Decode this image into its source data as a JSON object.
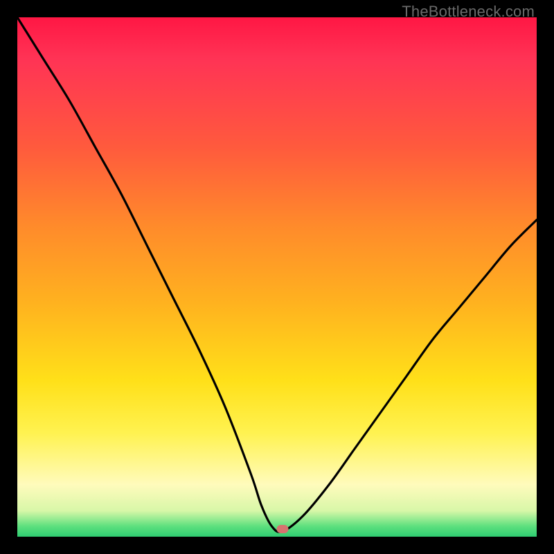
{
  "watermark": "TheBottleneck.com",
  "chart_data": {
    "type": "line",
    "title": "",
    "xlabel": "",
    "ylabel": "",
    "xlim": [
      0,
      100
    ],
    "ylim": [
      0,
      100
    ],
    "grid": false,
    "annotations": [
      {
        "type": "marker",
        "x": 51,
        "y": 1.5,
        "color": "#d6736f"
      }
    ],
    "series": [
      {
        "name": "curve",
        "color": "#000000",
        "x": [
          0,
          5,
          10,
          15,
          20,
          25,
          30,
          35,
          40,
          45,
          47,
          49,
          51,
          55,
          60,
          65,
          70,
          75,
          80,
          85,
          90,
          95,
          100
        ],
        "values": [
          100,
          92,
          84,
          75,
          66,
          56,
          46,
          36,
          25,
          12,
          6,
          2,
          1,
          4,
          10,
          17,
          24,
          31,
          38,
          44,
          50,
          56,
          61
        ]
      }
    ],
    "background_gradient": {
      "type": "linear-vertical",
      "stops": [
        {
          "pos": 0,
          "color": "#ff1744"
        },
        {
          "pos": 25,
          "color": "#ff5a3d"
        },
        {
          "pos": 55,
          "color": "#ffb21f"
        },
        {
          "pos": 80,
          "color": "#fff250"
        },
        {
          "pos": 95,
          "color": "#d8f7a8"
        },
        {
          "pos": 100,
          "color": "#2ecc71"
        }
      ]
    }
  }
}
